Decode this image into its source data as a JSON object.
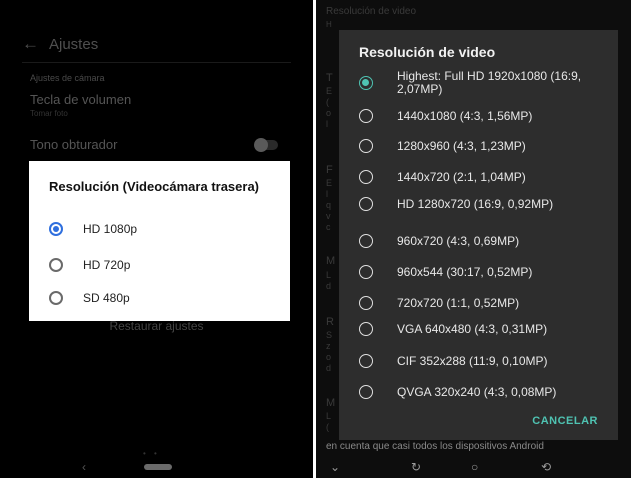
{
  "left": {
    "header": {
      "back_icon": "arrow-left-icon",
      "title": "Ajustes"
    },
    "section_label": "Ajustes de cámara",
    "volume_item": {
      "title": "Tecla de volumen",
      "subtitle": "Tomar foto"
    },
    "shutter_item": {
      "title": "Tono obturador"
    },
    "restore_label": "Restaurar ajustes",
    "dialog": {
      "title": "Resolución (Videocámara trasera)",
      "selected_index": 0,
      "options": [
        {
          "label": "HD 1080p"
        },
        {
          "label": "HD 720p"
        },
        {
          "label": "SD 480p"
        }
      ]
    }
  },
  "right": {
    "bg": {
      "top_label": "Resolución de video",
      "top_sub": "H",
      "letters": [
        "T",
        "E",
        "(",
        "o",
        "l",
        "F",
        "E",
        "l",
        "q",
        "v",
        "c",
        "M",
        "L",
        "d",
        "R",
        "S",
        "z",
        "o",
        "d",
        "M",
        "L",
        "("
      ],
      "bottom_line1": "en cuenta que casi todos los dispositivos Android"
    },
    "dialog": {
      "title": "Resolución de video",
      "selected_index": 0,
      "options": [
        {
          "label": "Highest: Full HD 1920x1080 (16:9, 2,07MP)"
        },
        {
          "label": "1440x1080 (4:3, 1,56MP)"
        },
        {
          "label": "1280x960 (4:3, 1,23MP)"
        },
        {
          "label": "1440x720 (2:1, 1,04MP)"
        },
        {
          "label": "HD 1280x720 (16:9, 0,92MP)"
        },
        {
          "label": "960x720 (4:3, 0,69MP)"
        },
        {
          "label": "960x544 (30:17, 0,52MP)"
        },
        {
          "label": "720x720 (1:1, 0,52MP)"
        },
        {
          "label": "VGA 640x480 (4:3, 0,31MP)"
        },
        {
          "label": "CIF 352x288 (11:9, 0,10MP)"
        },
        {
          "label": "QVGA 320x240 (4:3, 0,08MP)"
        }
      ],
      "cancel_label": "CANCELAR"
    },
    "nav": {
      "icons": [
        "chevron-down-icon",
        "rotate-icon",
        "home-circle-icon",
        "screen-rotate-icon"
      ]
    }
  },
  "colors": {
    "accent_teal": "#4fc3b2",
    "accent_blue": "#2f6fde"
  }
}
